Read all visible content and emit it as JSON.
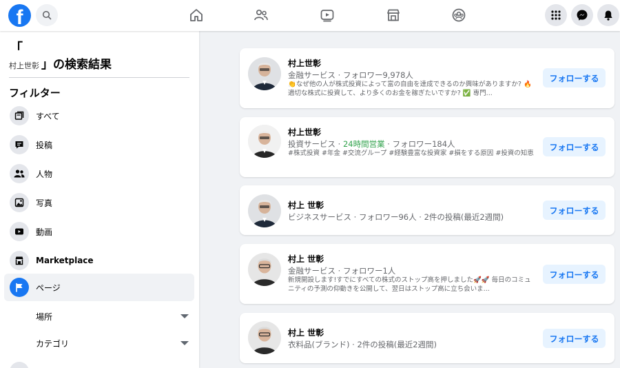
{
  "topbar": {
    "logo_letter": "f",
    "icons": [
      "search-icon",
      "home-icon",
      "friends-icon",
      "watch-icon",
      "marketplace-icon",
      "groups-icon",
      "menu-grid-icon",
      "messenger-icon",
      "bell-icon"
    ]
  },
  "sidebar": {
    "heading_open": "「",
    "query": "村上世彰",
    "heading_suffix": "」の検索結果",
    "filter_title": "フィルター",
    "items": [
      {
        "label": "すべて",
        "icon": "all-results-icon"
      },
      {
        "label": "投稿",
        "icon": "posts-icon"
      },
      {
        "label": "人物",
        "icon": "people-icon"
      },
      {
        "label": "写真",
        "icon": "photos-icon"
      },
      {
        "label": "動画",
        "icon": "videos-icon"
      },
      {
        "label": "Marketplace",
        "icon": "marketplace-icon"
      },
      {
        "label": "ページ",
        "icon": "flag-icon",
        "active": true
      }
    ],
    "sub_filters": [
      {
        "label": "場所"
      },
      {
        "label": "カテゴリ"
      }
    ]
  },
  "results": [
    {
      "name": "村上世彰",
      "meta": "金融サービス · フォロワー9,978人",
      "desc": "👏なぜ他の人が株式投資によって富の自由を達成できるのか興味がありますか? 🔥 適切な株式に投資して、より多くのお金を稼ぎたいですか? ✅ 専門...",
      "button": "フォローする"
    },
    {
      "name": "村上世彰",
      "meta_pre": "投資サービス · ",
      "meta_green": "24時間営業",
      "meta_post": " · フォロワー184人",
      "desc": "#株式投資 #年金 #交流グループ #経験豊富な投資家 #損をする原因 #投資の知恵",
      "button": "フォローする"
    },
    {
      "name": "村上 世彰",
      "meta": "ビジネスサービス · フォロワー96人 · 2件の投稿(最近2週間)",
      "button": "フォローする"
    },
    {
      "name": "村上 世彰",
      "meta": "金融サービス · フォロワー1人",
      "desc": "新規開設します!すでにすべての株式のストップ高を押しました🚀🚀 毎日のコミュニティの予測の仰動きを公開して、翌日はストップ高に立ち会いま...",
      "button": "フォローする"
    },
    {
      "name": "村上 世彰",
      "meta": "衣料品(ブランド) · 2件の投稿(最近2週間)",
      "button": "フォローする"
    }
  ]
}
